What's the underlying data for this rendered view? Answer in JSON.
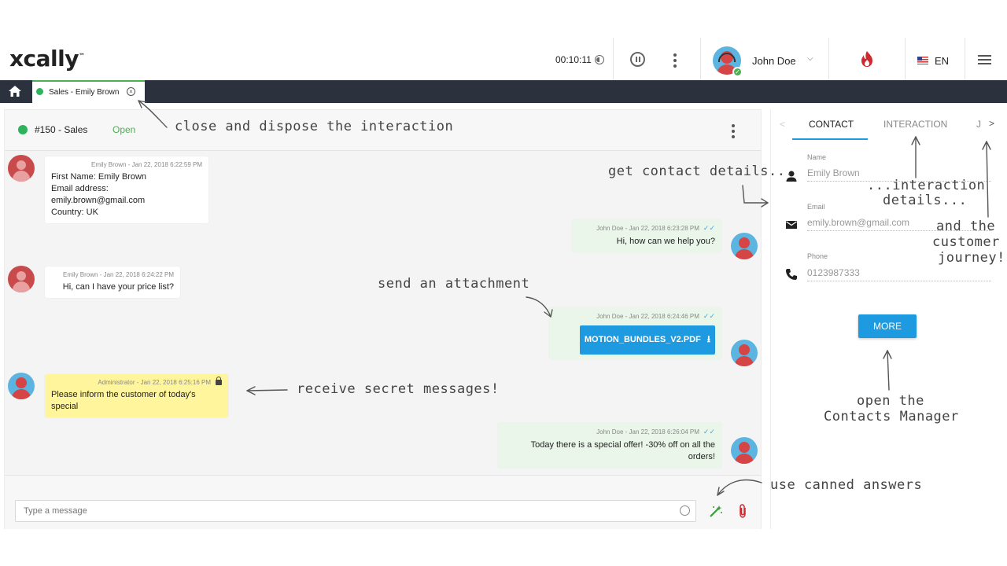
{
  "header": {
    "logo": "xcally",
    "logo_tm": "™",
    "timer": "00:10:11",
    "user_name": "John Doe",
    "language": "EN"
  },
  "tabs": {
    "active_label": "Sales - Emily Brown"
  },
  "interaction": {
    "id": "#150 - Sales",
    "state": "Open"
  },
  "messages": [
    {
      "meta": "Emily Brown - Jan 22, 2018 6:22:59 PM",
      "lines": [
        "First Name: Emily Brown",
        "Email address: emily.brown@gmail.com",
        "Country: UK"
      ]
    },
    {
      "meta": "John Doe - Jan 22, 2018 6:23:28 PM",
      "lines": [
        "Hi, how can we help you?"
      ]
    },
    {
      "meta": "Emily Brown - Jan 22, 2018 6:24:22 PM",
      "lines": [
        "Hi, can I have your price list?"
      ]
    },
    {
      "meta": "John Doe - Jan 22, 2018 6:24:46 PM",
      "attachment": "MOTION_BUNDLES_V2.PDF"
    },
    {
      "meta": "Administrator - Jan 22, 2018 6:25:16 PM",
      "lines": [
        "Please inform the customer of today's special"
      ]
    },
    {
      "meta": "John Doe - Jan 22, 2018 6:26:04 PM",
      "lines": [
        "Today there is a special offer! -30% off on all the orders!"
      ]
    }
  ],
  "composer": {
    "placeholder": "Type a message"
  },
  "side": {
    "tabs": [
      "CONTACT",
      "INTERACTION",
      "J"
    ],
    "fields": [
      {
        "label": "Name",
        "value": "Emily Brown"
      },
      {
        "label": "Email",
        "value": "emily.brown@gmail.com"
      },
      {
        "label": "Phone",
        "value": "0123987333"
      }
    ],
    "more_label": "MORE"
  },
  "annotations": {
    "close": "close and dispose the interaction",
    "contact": "get contact details...",
    "interaction_1": "...interaction",
    "interaction_2": "details...",
    "journey_1": "and the",
    "journey_2": "customer",
    "journey_3": "journey!",
    "attachment": "send an attachment",
    "secret": "receive secret messages!",
    "manager_1": "open the",
    "manager_2": "Contacts Manager",
    "canned": "use canned answers"
  },
  "colors": {
    "accent": "#1e9be0",
    "open_status": "#4caf50",
    "tabbar": "#2c323d",
    "secret_bg": "#fff59d",
    "outgoing_bg": "#eaf6ea"
  }
}
